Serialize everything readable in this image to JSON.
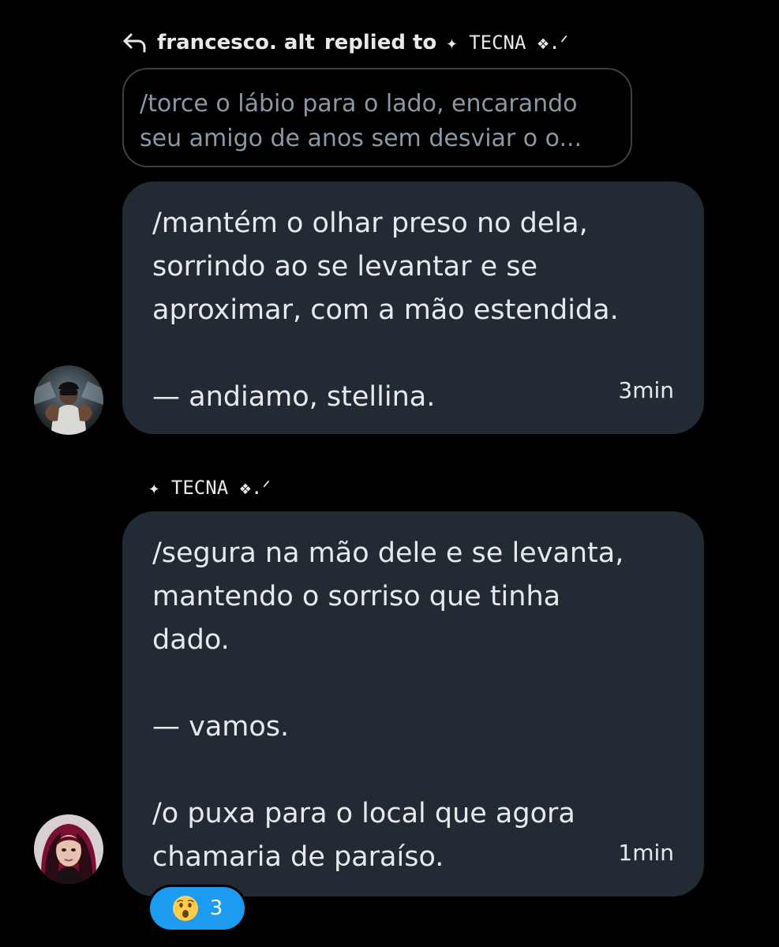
{
  "reply_header": {
    "replier": "francesco. alt",
    "action": "replied to",
    "target": "✦ TECNA ❖.ᐟ"
  },
  "quoted_message": {
    "lines": [
      "/torce o lábio para o lado, encarando",
      "seu amigo de anos sem desviar o o..."
    ]
  },
  "messages": [
    {
      "lines": [
        "/mantém o olhar preso no dela,",
        "sorrindo ao se levantar e se",
        "aproximar, com a mão estendida.",
        "",
        "— andiamo, stellina."
      ],
      "time": "3min",
      "avatar": "avatar-francesco"
    },
    {
      "sender": "✦ TECNA ❖.ᐟ",
      "lines": [
        "/segura na mão dele e se levanta,",
        "mantendo o sorriso que tinha",
        "dado.",
        "",
        "— vamos.",
        "",
        "/o puxa para o local que agora",
        "chamaria de paraíso."
      ],
      "time": "1min",
      "avatar": "avatar-tecna",
      "reaction": {
        "emoji": "astonished-face-icon",
        "count": "3"
      }
    }
  ],
  "colors": {
    "background": "#000000",
    "bubble": "#222b33",
    "quoted_border": "#3e4144",
    "quoted_text": "#8b98a5",
    "text": "#e7e9ea",
    "reaction_bg": "#1d9bf0"
  }
}
